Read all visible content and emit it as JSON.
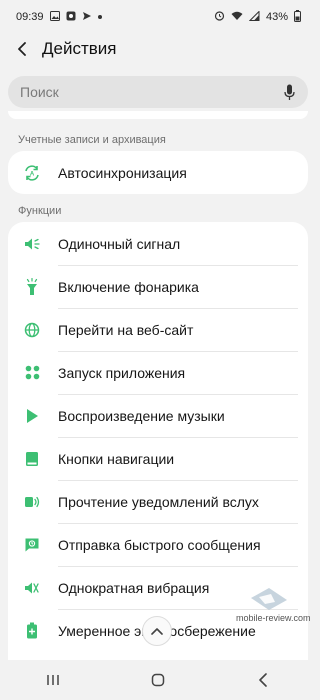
{
  "status_bar": {
    "time": "09:39",
    "battery": "43%",
    "left_icons": [
      "image-icon",
      "notification-dot-icon",
      "send-icon",
      "dot-icon"
    ],
    "right_icons": [
      "alarm-icon",
      "wifi-icon",
      "signal-icon"
    ]
  },
  "header": {
    "title": "Действия",
    "back_icon": "back-arrow-icon"
  },
  "search": {
    "placeholder": "Поиск",
    "icon": "microphone-icon"
  },
  "sections": [
    {
      "label": "Учетные записи и архивация",
      "items": [
        {
          "label": "Автосинхронизация",
          "icon": "sync-icon"
        }
      ]
    },
    {
      "label": "Функции",
      "items": [
        {
          "label": "Одиночный сигнал",
          "icon": "volume-icon"
        },
        {
          "label": "Включение фонарика",
          "icon": "flashlight-icon"
        },
        {
          "label": "Перейти на веб-сайт",
          "icon": "globe-icon"
        },
        {
          "label": "Запуск приложения",
          "icon": "apps-grid-icon"
        },
        {
          "label": "Воспроизведение музыки",
          "icon": "play-icon"
        },
        {
          "label": "Кнопки навигации",
          "icon": "navigation-buttons-icon"
        },
        {
          "label": "Прочтение уведомлений вслух",
          "icon": "speaker-notification-icon"
        },
        {
          "label": "Отправка быстрого сообщения",
          "icon": "quick-message-icon"
        },
        {
          "label": "Однократная вибрация",
          "icon": "vibration-icon"
        },
        {
          "label": "Умеренное энергосбережение",
          "icon": "battery-saver-icon"
        }
      ]
    }
  ],
  "watermark": "mobile-review.com",
  "colors": {
    "accent": "#3dbf73",
    "background": "#f2f2f2",
    "card": "#ffffff"
  },
  "navbar": {
    "icons": [
      "recent-apps-icon",
      "home-icon",
      "back-icon"
    ]
  }
}
